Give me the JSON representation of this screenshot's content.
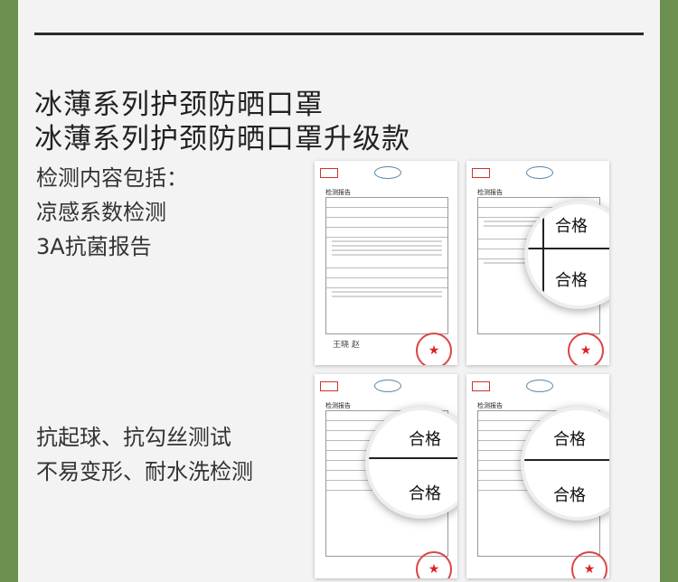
{
  "titles": [
    "冰薄系列护颈防晒口罩",
    "冰薄系列护颈防晒口罩升级款"
  ],
  "tests_block_1": [
    "检测内容包括：",
    "凉感系数检测",
    "3A抗菌报告"
  ],
  "tests_block_2": [
    "抗起球、抗勾丝测试",
    "不易变形、耐水洗检测"
  ],
  "report_title": "检测报告",
  "pass_label": "合格",
  "signature": "王晓 赵"
}
